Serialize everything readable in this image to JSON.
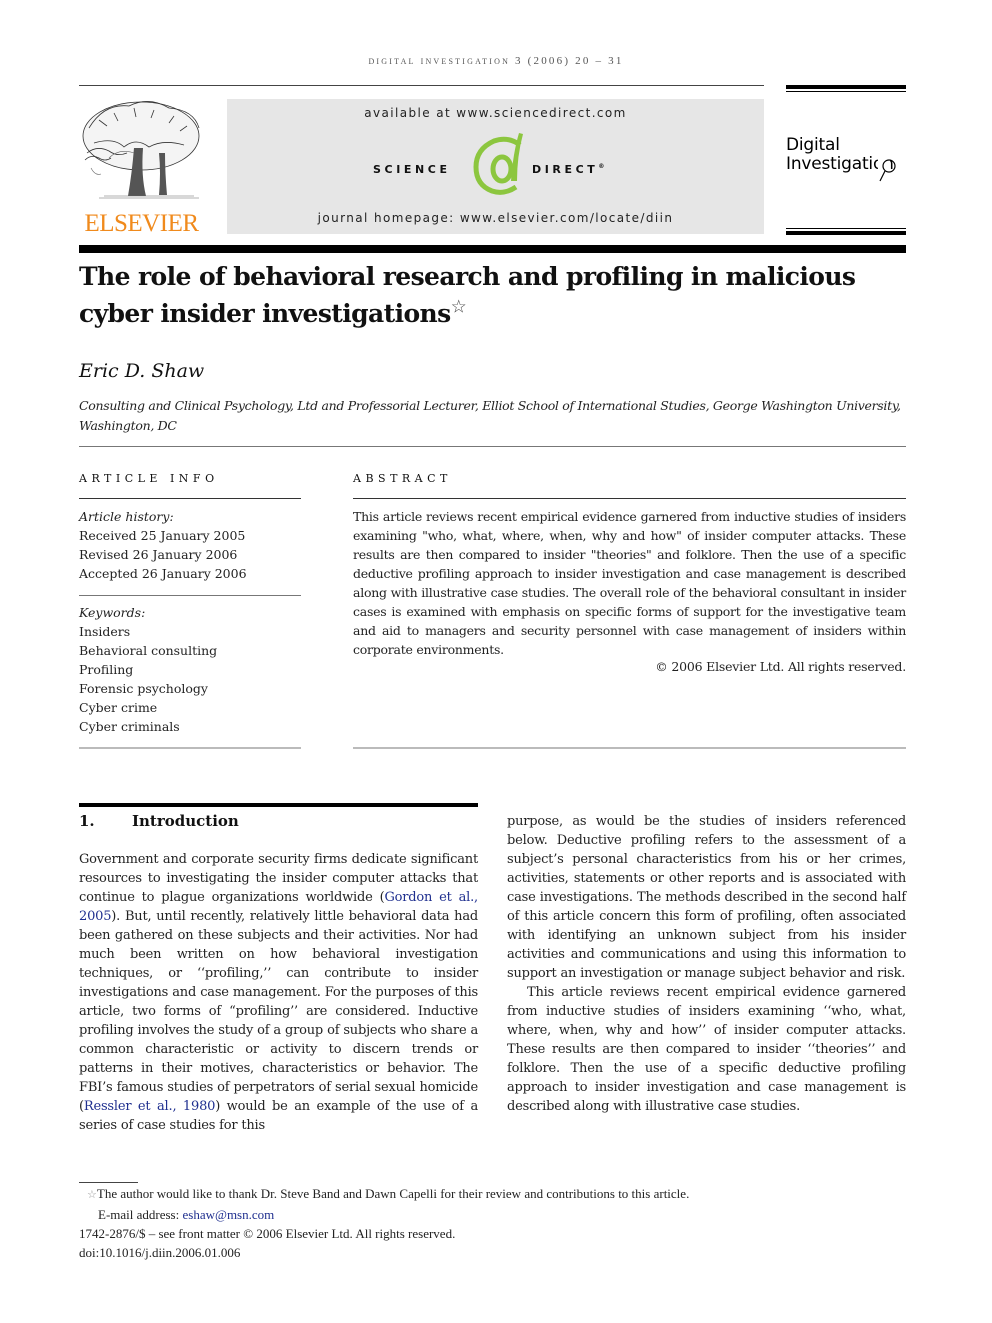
{
  "running_head": "digital investigation 3 (2006) 20 – 31",
  "publisher": {
    "name": "ELSEVIER",
    "logo_color": "#f08a1c"
  },
  "sciencedirect": {
    "available": "available at www.sciencedirect.com",
    "logo_left": "SCIENCE",
    "logo_at": "d",
    "logo_right": "DIRECT",
    "logo_mark": "®",
    "at_color": "#8cc63f",
    "homepage": "journal homepage: www.elsevier.com/locate/diin"
  },
  "journal": {
    "line1": "Digital",
    "line2": "Investigation"
  },
  "article": {
    "title": "The role of behavioral research and profiling in malicious cyber insider investigations",
    "title_footnote_mark": "☆",
    "author": "Eric D. Shaw",
    "affiliation": "Consulting and Clinical Psychology, Ltd  and Professorial Lecturer, Elliot School of International Studies, George Washington University, Washington, DC"
  },
  "article_info": {
    "heading": "ARTICLE INFO",
    "history_label": "Article history:",
    "history": [
      "Received 25 January 2005",
      "Revised 26 January 2006",
      "Accepted 26 January 2006"
    ],
    "keywords_label": "Keywords:",
    "keywords": [
      "Insiders",
      "Behavioral consulting",
      "Profiling",
      "Forensic psychology",
      "Cyber crime",
      "Cyber criminals"
    ]
  },
  "abstract": {
    "heading": "ABSTRACT",
    "text": "This article reviews recent empirical evidence garnered from inductive studies of insiders examining \"who, what, where, when, why and how\" of insider computer attacks. These results are then compared to insider \"theories\" and folklore. Then the use of a specific deductive profiling approach to insider investigation and case management is described along with illustrative case studies.  The overall role of the behavioral consultant in insider cases is examined with emphasis on specific forms of support for the investigative team and aid to managers and security personnel with case management of insiders within corporate environments.",
    "copyright": "© 2006 Elsevier Ltd. All rights reserved."
  },
  "introduction": {
    "number": "1.",
    "heading": "Introduction",
    "p1_a": "Government and corporate security firms dedicate significant resources to investigating the insider computer attacks that continue to plague organizations worldwide (",
    "p1_cite1": "Gordon et al., 2005",
    "p1_b": "). But, until recently, relatively little behavioral data had been gathered on these subjects and their activities. Nor had much been written on how behavioral investigation techniques, or ‘‘profiling,’’ can contribute to insider investigations and case management. For the purposes of this article, two forms of “profiling’’ are considered. Inductive profiling involves the study of a group of subjects who share a common characteristic or activity to discern trends or patterns in their motives, characteristics or behavior. The FBI’s famous studies of perpetrators of serial sexual homicide (",
    "p1_cite2": "Ressler et al., 1980",
    "p1_c": ") would be an example of the use of a series of case studies for this purpose, as would be the studies of insiders referenced below. Deductive profiling refers to the assessment of a subject’s personal characteristics from his or her crimes, activities, statements or other reports and is associated with case investigations. The methods described in the second half of this article concern this form of profiling, often associated with identifying an unknown subject from his insider activities and communications and using this information to support an investigation or manage subject behavior and risk.",
    "p2": "This article reviews recent empirical evidence garnered from inductive studies of insiders examining ‘‘who, what, where, when, why and how’’ of insider computer attacks. These results are then compared to insider ‘‘theories’’ and folklore. Then the use of a specific deductive profiling approach to insider investigation and case management is described along with illustrative case studies."
  },
  "footnotes": {
    "star_mark": "☆",
    "acknowledgment": "The author would like to thank Dr. Steve Band and Dawn Capelli for their review and contributions to this article.",
    "email_label": "E-mail address: ",
    "email": "eshaw@msn.com",
    "front_matter": "1742-2876/$ – see front matter © 2006 Elsevier Ltd. All rights reserved.",
    "doi": "doi:10.1016/j.diin.2006.01.006"
  }
}
